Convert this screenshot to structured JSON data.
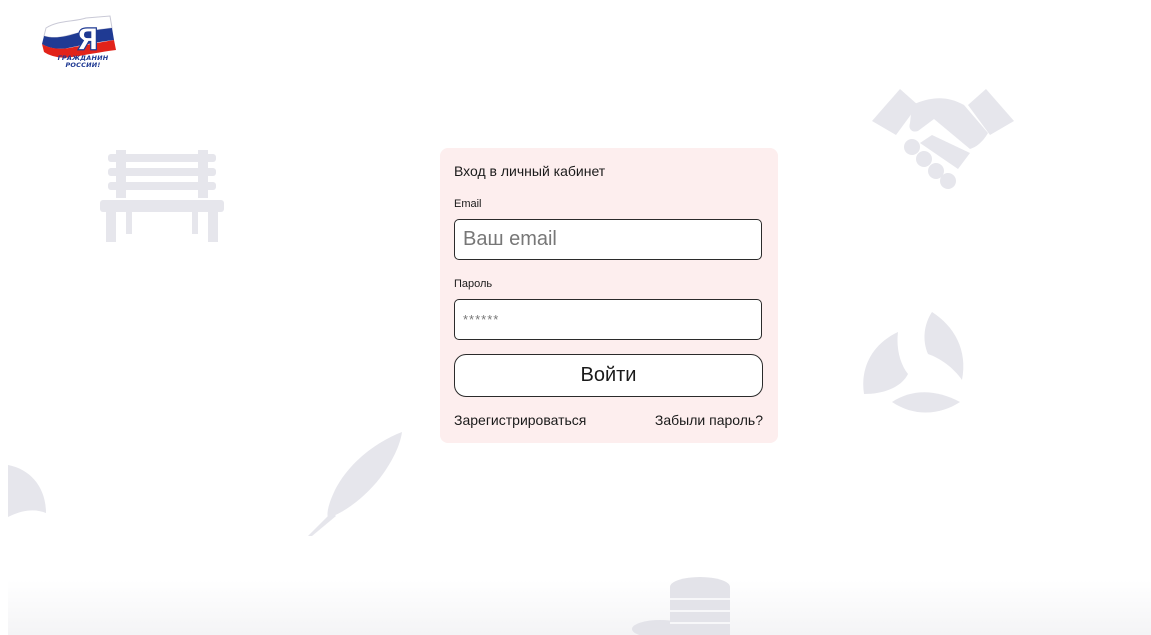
{
  "logo": {
    "letter": "Я",
    "text_line1": "ГРАЖДАНИН",
    "text_line2": "РОССИИ!"
  },
  "login": {
    "title": "Вход в личный кабинет",
    "email_label": "Email",
    "email_placeholder": "Ваш email",
    "password_label": "Пароль",
    "password_placeholder": "******",
    "submit_label": "Войти",
    "register_link": "Зарегистрироваться",
    "forgot_link": "Забыли пароль?"
  },
  "background_icons": [
    "bench-icon",
    "handshake-icon",
    "recycle-leaves-icon",
    "feather-icon",
    "half-circle-icon",
    "coins-icon"
  ],
  "colors": {
    "card_background": "#fdeeee",
    "icon_gray": "#e6e6ec",
    "flag_white": "#ffffff",
    "flag_blue": "#1f3a93",
    "flag_red": "#e2231a"
  }
}
